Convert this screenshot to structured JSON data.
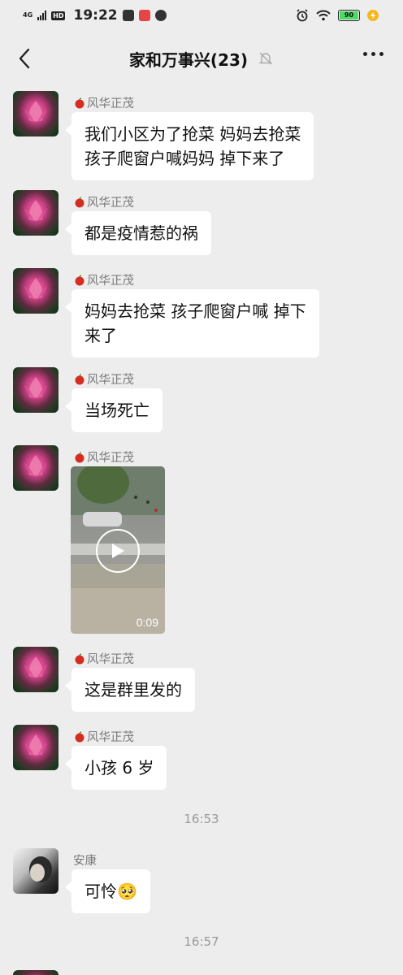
{
  "status_bar": {
    "network": "4G",
    "hd": "HD",
    "time": "19:22",
    "battery": "90"
  },
  "header": {
    "title": "家和万事兴(23)"
  },
  "colors": {
    "background": "#ededed",
    "bubble": "#ffffff",
    "sender_name": "#7a7a7a"
  },
  "messages": [
    {
      "sender": "风华正茂",
      "text": [
        "我们小区为了抢菜 妈妈去抢菜",
        "孩子爬窗户喊妈妈 掉下来了"
      ]
    },
    {
      "sender": "风华正茂",
      "text": [
        "都是疫情惹的祸"
      ]
    },
    {
      "sender": "风华正茂",
      "text": [
        "妈妈去抢菜 孩子爬窗户喊 掉下",
        "来了"
      ]
    },
    {
      "sender": "风华正茂",
      "text": [
        "当场死亡"
      ]
    },
    {
      "sender": "风华正茂",
      "video_duration": "0:09"
    },
    {
      "sender": "风华正茂",
      "text": [
        "这是群里发的"
      ]
    },
    {
      "sender": "风华正茂",
      "text": [
        "小孩 6 岁"
      ]
    },
    {
      "sender": "安康",
      "text": [
        "可怜🥺"
      ]
    }
  ],
  "timestamps": [
    "16:53",
    "16:57"
  ],
  "icons": [
    "back-chevron-icon",
    "mute-bell-icon",
    "more-dots-icon",
    "apple-emoji-icon",
    "play-icon",
    "wifi-icon",
    "alarm-icon"
  ]
}
